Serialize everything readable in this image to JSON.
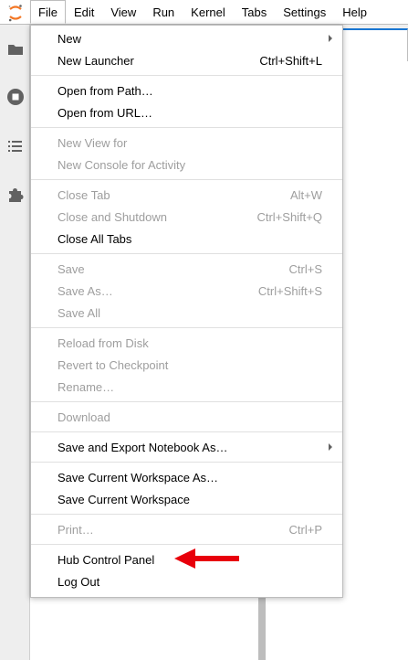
{
  "menubar": {
    "items": [
      {
        "label": "File",
        "active": true
      },
      {
        "label": "Edit"
      },
      {
        "label": "View"
      },
      {
        "label": "Run"
      },
      {
        "label": "Kernel"
      },
      {
        "label": "Tabs"
      },
      {
        "label": "Settings"
      },
      {
        "label": "Help"
      }
    ],
    "logo_icon": "jupyter-logo-icon"
  },
  "activitybar": {
    "icons": [
      "folder-icon",
      "running-stop-icon",
      "toc-list-icon",
      "extension-puzzle-icon"
    ]
  },
  "file_menu": {
    "groups": [
      [
        {
          "label": "New",
          "shortcut": "",
          "enabled": true,
          "submenu": true
        },
        {
          "label": "New Launcher",
          "shortcut": "Ctrl+Shift+L",
          "enabled": true
        }
      ],
      [
        {
          "label": "Open from Path…",
          "shortcut": "",
          "enabled": true
        },
        {
          "label": "Open from URL…",
          "shortcut": "",
          "enabled": true
        }
      ],
      [
        {
          "label": "New View for",
          "shortcut": "",
          "enabled": false
        },
        {
          "label": "New Console for Activity",
          "shortcut": "",
          "enabled": false
        }
      ],
      [
        {
          "label": "Close Tab",
          "shortcut": "Alt+W",
          "enabled": false
        },
        {
          "label": "Close and Shutdown",
          "shortcut": "Ctrl+Shift+Q",
          "enabled": false
        },
        {
          "label": "Close All Tabs",
          "shortcut": "",
          "enabled": true
        }
      ],
      [
        {
          "label": "Save",
          "shortcut": "Ctrl+S",
          "enabled": false
        },
        {
          "label": "Save As…",
          "shortcut": "Ctrl+Shift+S",
          "enabled": false
        },
        {
          "label": "Save All",
          "shortcut": "",
          "enabled": false
        }
      ],
      [
        {
          "label": "Reload from Disk",
          "shortcut": "",
          "enabled": false
        },
        {
          "label": "Revert to Checkpoint",
          "shortcut": "",
          "enabled": false
        },
        {
          "label": "Rename…",
          "shortcut": "",
          "enabled": false
        }
      ],
      [
        {
          "label": "Download",
          "shortcut": "",
          "enabled": false
        }
      ],
      [
        {
          "label": "Save and Export Notebook As…",
          "shortcut": "",
          "enabled": true,
          "submenu": true
        }
      ],
      [
        {
          "label": "Save Current Workspace As…",
          "shortcut": "",
          "enabled": true
        },
        {
          "label": "Save Current Workspace",
          "shortcut": "",
          "enabled": true
        }
      ],
      [
        {
          "label": "Print…",
          "shortcut": "Ctrl+P",
          "enabled": false
        }
      ],
      [
        {
          "label": "Hub Control Panel",
          "shortcut": "",
          "enabled": true,
          "annotated": true
        },
        {
          "label": "Log Out",
          "shortcut": "",
          "enabled": true
        }
      ]
    ]
  },
  "colors": {
    "annotation_arrow": "#e8000b",
    "disabled_text": "#9e9e9e",
    "accent": "#1976d2",
    "logo_orange": "#f37726"
  }
}
